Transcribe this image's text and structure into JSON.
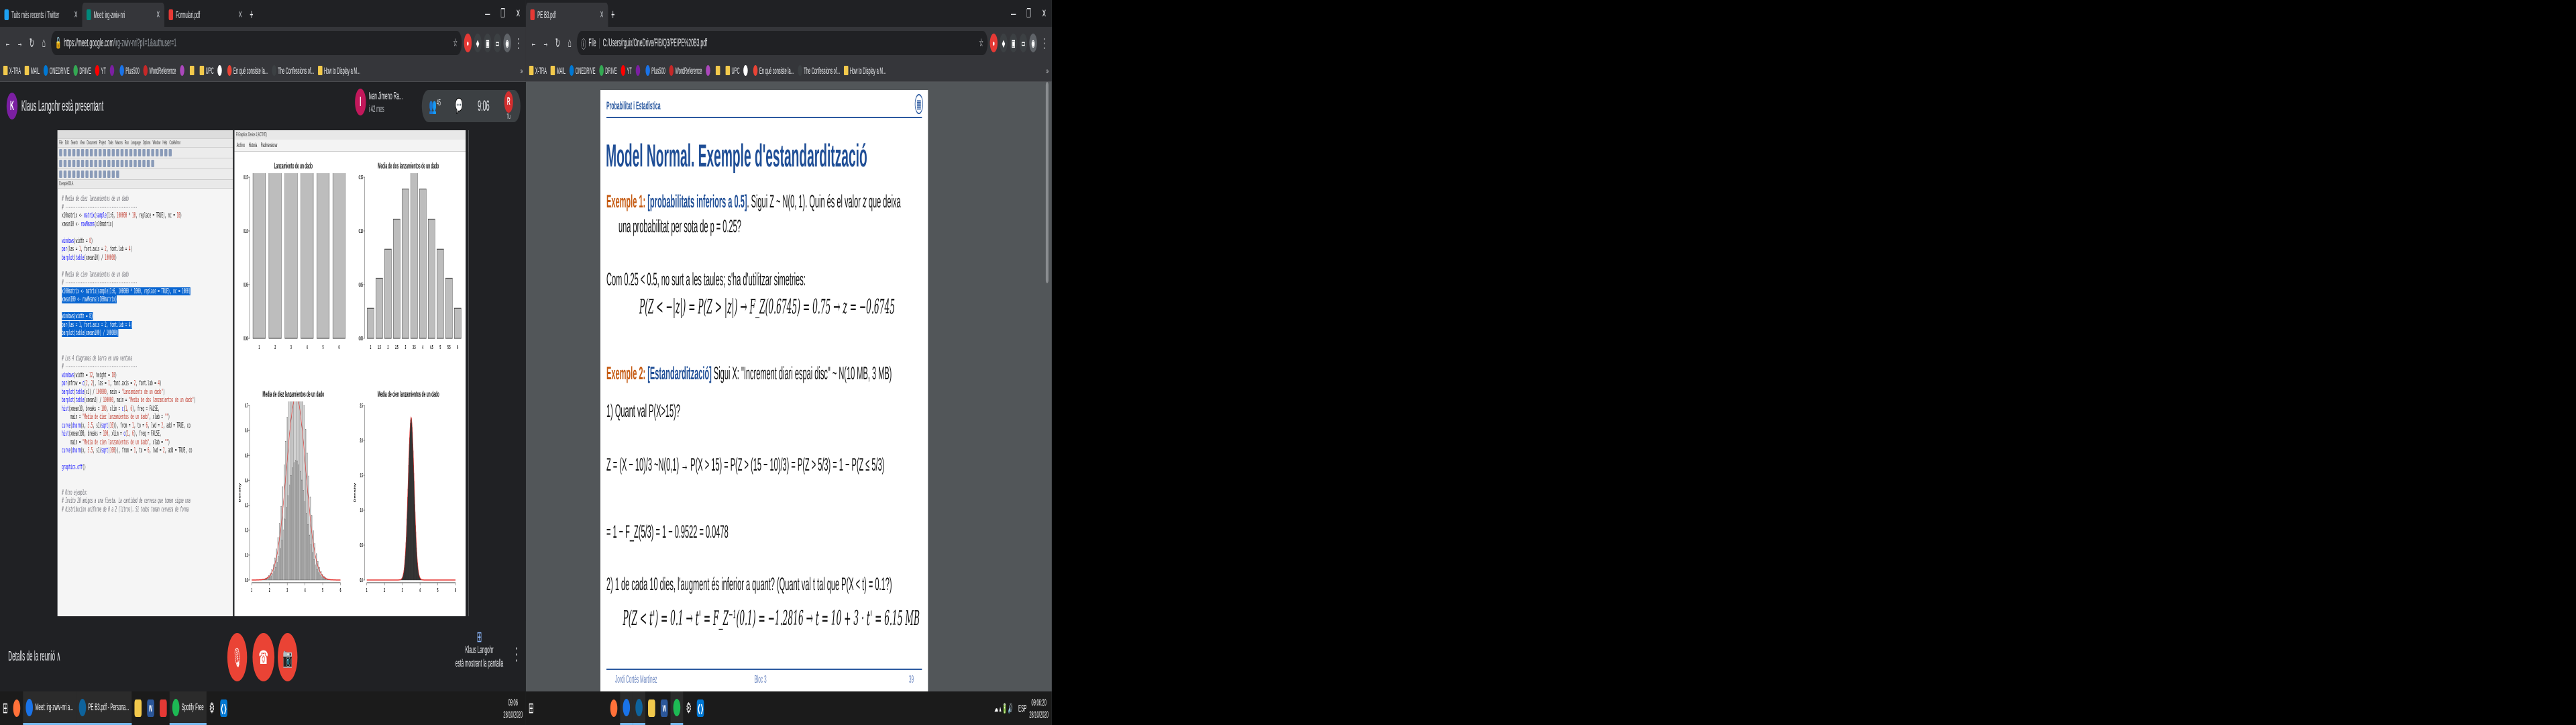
{
  "left": {
    "tabs": [
      {
        "label": "Tuits més recents / Twitter",
        "color": "#1da1f2"
      },
      {
        "label": "Meet: irg-zwiv-nri",
        "color": "#00897b"
      },
      {
        "label": "Formulari.pdf",
        "color": "#e53935"
      }
    ],
    "url_host": "https://meet.google.com",
    "url_path": "/irg-zwiv-nri?pli=1&authuser=1",
    "bookmarks": [
      "X-TRA",
      "MAIL",
      "ONEDRIVE",
      "DRIVE",
      "YT",
      "",
      "Plus500",
      "WordReference",
      "",
      "",
      "UPC",
      "",
      "En qué consiste la...",
      "The Confessions of...",
      "How to Display a M..."
    ],
    "meet": {
      "presenter_initial": "K",
      "presenter_text": "Klaus Langohr està presentant",
      "participant_initial": "I",
      "participant_name": "Ivan Jimeno Ra...",
      "participant_time": "i 42 mes",
      "people_count": "45",
      "time": "9:06",
      "you_label": "Tu",
      "self_initial": "R",
      "details_label": "Detalls de la reunió",
      "presenting_name": "Klaus Langohr",
      "presenting_text": "està mostrant la pantalla"
    },
    "rstudio": {
      "menu": [
        "File",
        "Edit",
        "Search",
        "View",
        "Document",
        "Project",
        "Tools",
        "Macros",
        "Run",
        "Language",
        "Options",
        "Window",
        "Help",
        "CodeMirror"
      ],
      "tab": "Exemple3OLA"
    },
    "plots_window": {
      "title": "R Graphics: Device 4 (ACTIVE)",
      "menu": [
        "Archivo",
        "Historia",
        "Redimensionar"
      ]
    }
  },
  "right": {
    "tabs": [
      {
        "label": "PE B3.pdf",
        "color": "#e53935"
      }
    ],
    "url_prefix": "File",
    "url_path": "C:/Users/rguix/OneDrive/FIB/Q3/PE/PE%20B3.pdf",
    "bookmarks": [
      "X-TRA",
      "MAIL",
      "ONEDRIVE",
      "DRIVE",
      "YT",
      "",
      "Plus500",
      "WordReference",
      "",
      "",
      "UPC",
      "",
      "En qué consiste la...",
      "The Confessions of...",
      "How to Display a M..."
    ],
    "pdf": {
      "header": "Probabilitat i Estadística",
      "title": "Model Normal. Exemple d'estandardització",
      "ex1_label": "Exemple 1",
      "ex1_tag": "[probabilitats inferiors a 0.5]",
      "ex1_text_a": ". Sigui Z ~ N(0, 1). Quin és el valor ",
      "ex1_z": "z",
      "ex1_text_b": " que deixa",
      "ex1_text_c": "una probabilitat per sota de p = 0.25?",
      "line_sym": "Com 0.25 < 0.5, no surt a les taules; s'ha d'utilitzar simetries:",
      "eq1": "P(Z < −|z|) = P(Z > |z|) → F_Z(0.6745) = 0.75 → z = −0.6745",
      "ex2_label": "Exemple 2",
      "ex2_tag": "[Estandardització]",
      "ex2_text": "Sigui X: \"Increment diari espai disc\" ~ N(10 MB, 3 MB)",
      "q1": "1)     Quant val P(X>15)?",
      "eq2": "Z = (X − 10)/3 ~N(0,1) → P(X > 15) = P(Z > (15 − 10)/3) = P(Z > 5/3) = 1 − P(Z ≤ 5/3)",
      "eq3": "= 1 − F_Z(5/3) = 1 − 0.9522 = 0.0478",
      "q2": "2)     1 de cada 10 dies, l'augment és inferior a quant? (Quant val t tal que P(X < t) = 0.1?)",
      "eq4": "P(Z < t') = 0.1 → t' = F_Z⁻¹(0.1) = −1.2816 → t = 10 + 3 · t' = 6.15 MB",
      "footer_author": "Jordi Cortés Martínez",
      "footer_block": "Bloc 3",
      "footer_page": "39"
    }
  },
  "taskbar_left": {
    "items": [
      {
        "label": "Meet: irg-zwiv-nri a...",
        "color": "#00897b"
      },
      {
        "label": "PE B3.pdf - Persona...",
        "color": "#0e639c"
      },
      {
        "label": "Spotify Free",
        "color": "#1db954"
      }
    ],
    "time": "09:06",
    "date": "28/10/2020"
  },
  "taskbar_right": {
    "lang": "ESP",
    "time": "09:06:20",
    "date": "28/10/2020"
  },
  "chart_data": [
    {
      "type": "bar",
      "title": "Lanzamiento de un dado",
      "categories": [
        "1",
        "2",
        "3",
        "4",
        "5",
        "6"
      ],
      "values": [
        0.166,
        0.167,
        0.167,
        0.166,
        0.167,
        0.167
      ],
      "ylim": [
        0,
        0.15
      ],
      "yticks": [
        "0.00",
        "0.05",
        "0.10",
        "0.15"
      ]
    },
    {
      "type": "bar",
      "title": "Media de dos lanzamientos de un dado",
      "categories": [
        "1",
        "1.5",
        "2",
        "2.5",
        "3",
        "3.5",
        "4",
        "4.5",
        "5",
        "5.5",
        "6"
      ],
      "values": [
        0.028,
        0.056,
        0.083,
        0.111,
        0.139,
        0.167,
        0.139,
        0.111,
        0.083,
        0.056,
        0.028
      ],
      "ylim": [
        0,
        0.15
      ],
      "yticks": [
        "0.00",
        "0.05",
        "0.10",
        "0.15"
      ]
    },
    {
      "type": "bar",
      "title": "Media de diez lanzamientos de un dado",
      "xlim": [
        1,
        6
      ],
      "ylim": [
        0,
        0.7
      ],
      "ylabel": "Density",
      "xticks": [
        "1",
        "2",
        "3",
        "4",
        "5",
        "6"
      ],
      "yticks": [
        "0.0",
        "0.1",
        "0.2",
        "0.3",
        "0.4",
        "0.5",
        "0.6",
        "0.7"
      ],
      "mean": 3.5,
      "sd": 0.54
    },
    {
      "type": "bar",
      "title": "Media de cien lanzamientos de un dado",
      "xlim": [
        1,
        6
      ],
      "ylim": [
        0,
        2.5
      ],
      "ylabel": "Density",
      "xticks": [
        "1",
        "2",
        "3",
        "4",
        "5",
        "6"
      ],
      "yticks": [
        "0.0",
        "0.5",
        "1.0",
        "1.5",
        "2.0",
        "2.5"
      ],
      "mean": 3.5,
      "sd": 0.171
    }
  ]
}
